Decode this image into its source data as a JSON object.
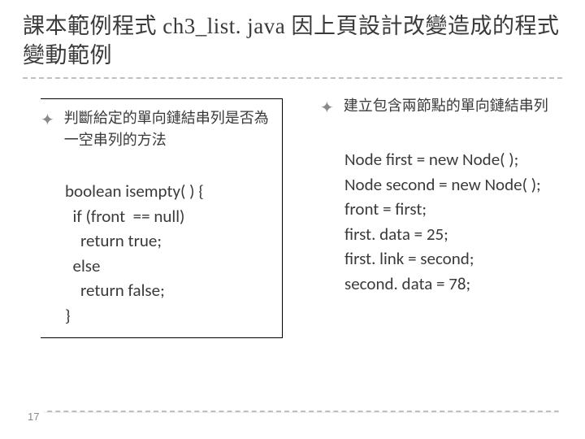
{
  "title": "課本範例程式 ch3_list. java 因上頁設計改變造成的程式變動範例",
  "left": {
    "bullet_text": "判斷給定的單向鏈結串列是否為一空串列的方法",
    "code_lines": [
      "boolean isempty( ) {",
      "  if (front  == null)",
      "    return true;",
      "  else",
      "    return false;",
      "}"
    ]
  },
  "right": {
    "bullet_text": "建立包含兩節點的單向鏈結串列",
    "code_lines": [
      "Node first = new Node( );",
      "Node second = new Node( );",
      "front = first;",
      "first. data = 25;",
      "first. link = second;",
      "second. data = 78;"
    ]
  },
  "page_number": "17"
}
